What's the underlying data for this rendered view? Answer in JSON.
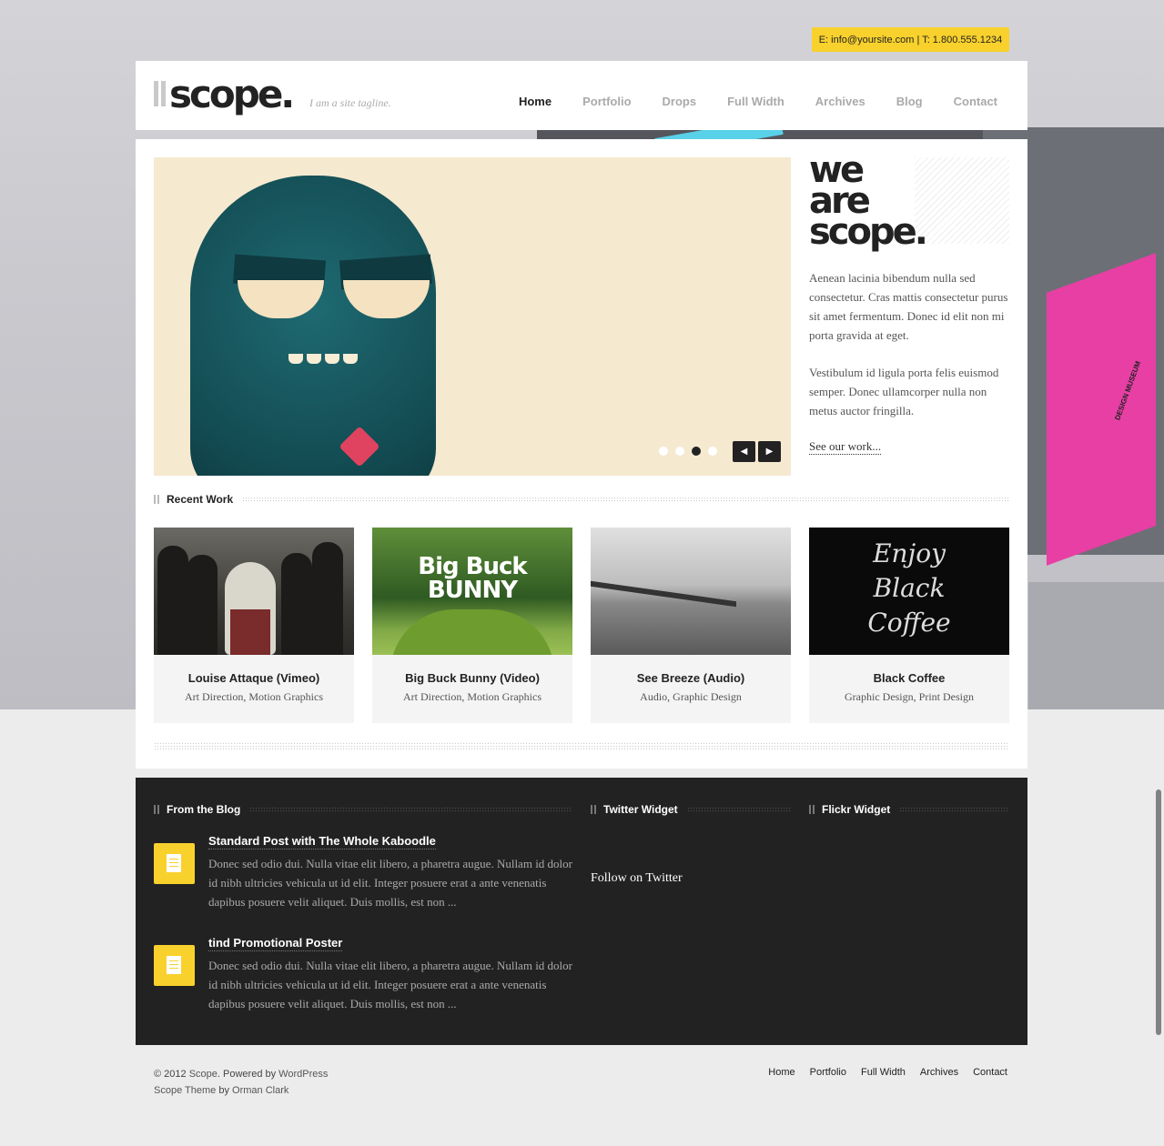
{
  "contact": {
    "text": "E: info@yoursite.com | T: 1.800.555.1234"
  },
  "header": {
    "logo": "scope.",
    "tagline": "I am a site tagline.",
    "nav": [
      "Home",
      "Portfolio",
      "Drops",
      "Full Width",
      "Archives",
      "Blog",
      "Contact"
    ],
    "active": "Home"
  },
  "slider": {
    "prev_icon": "chevron-left-icon",
    "next_icon": "chevron-right-icon",
    "prev_glyph": "◀",
    "next_glyph": "▶",
    "active_dot": 3,
    "dot_count": 4
  },
  "intro": {
    "heading": [
      "we",
      "are",
      "scope."
    ],
    "paragraphs": [
      "Aenean lacinia bibendum nulla sed consectetur. Cras mattis consectetur purus sit amet fermentum. Donec id elit non mi porta gravida at eget.",
      "Vestibulum id ligula porta felis euismod semper. Donec ullamcorper nulla non metus auctor fringilla."
    ],
    "link": "See our work..."
  },
  "recent": {
    "title": "Recent Work",
    "items": [
      {
        "title": "Louise Attaque (Vimeo)",
        "cats": "Art Direction, Motion Graphics"
      },
      {
        "title": "Big Buck Bunny (Video)",
        "cats": "Art Direction, Motion Graphics",
        "thumb_text": [
          "Big Buck",
          "BUNNY"
        ]
      },
      {
        "title": "See Breeze (Audio)",
        "cats": "Audio, Graphic Design"
      },
      {
        "title": "Black Coffee",
        "cats": "Graphic Design, Print Design",
        "thumb_text": [
          "Enjoy",
          "Black",
          "Coffee"
        ]
      }
    ]
  },
  "widgets": {
    "blog_title": "From the Blog",
    "twitter_title": "Twitter Widget",
    "flickr_title": "Flickr Widget",
    "posts": [
      {
        "title": "Standard Post with The Whole Kaboodle",
        "excerpt": "Donec sed odio dui. Nulla vitae elit libero, a pharetra augue. Nullam id dolor id nibh ultricies vehicula ut id elit. Integer posuere erat a ante venenatis dapibus posuere velit aliquet. Duis mollis, est non ..."
      },
      {
        "title": "tind Promotional Poster",
        "excerpt": "Donec sed odio dui. Nulla vitae elit libero, a pharetra augue. Nullam id dolor id nibh ultricies vehicula ut id elit. Integer posuere erat a ante venenatis dapibus posuere velit aliquet. Duis mollis, est non ..."
      }
    ],
    "follow": "Follow on Twitter"
  },
  "footer": {
    "copyright_prefix": "© 2012",
    "site": "Scope",
    "powered": ". Powered by",
    "wordpress": "WordPress",
    "theme": "Scope Theme",
    "by": "by",
    "author": "Orman Clark",
    "nav": [
      "Home",
      "Portfolio",
      "Full Width",
      "Archives",
      "Contact"
    ]
  },
  "colors": {
    "accent": "#f9d12c",
    "dark": "#222222",
    "background": "#ececec"
  },
  "background_image": {
    "cover_text": "DESIGN MUSEUM"
  }
}
